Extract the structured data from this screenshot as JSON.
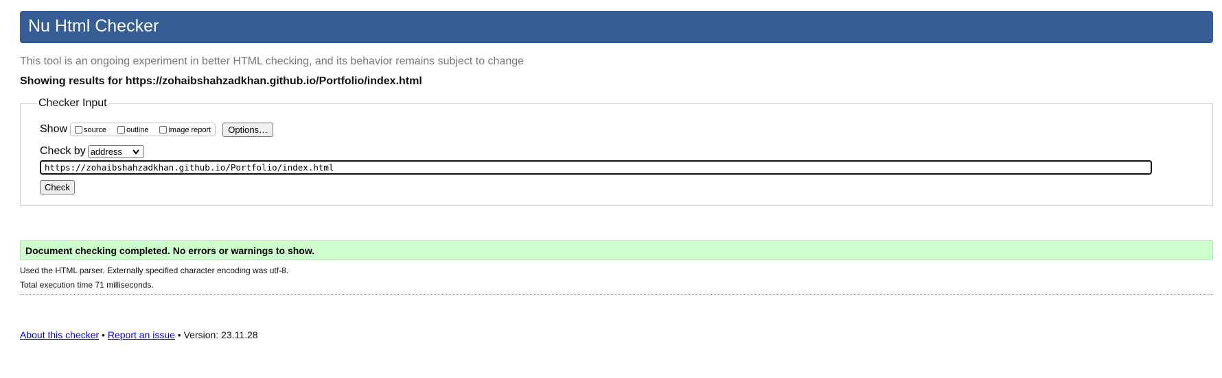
{
  "header": {
    "title": "Nu Html Checker",
    "background_color": "#365d95"
  },
  "subtitle": "This tool is an ongoing experiment in better HTML checking, and its behavior remains subject to change",
  "results_heading": {
    "prefix": "Showing results for ",
    "url": "https://zohaibshahzadkhan.github.io/Portfolio/index.html"
  },
  "checker_input": {
    "legend": "Checker Input",
    "show_label": "Show",
    "show_options": [
      {
        "label": "source",
        "checked": false
      },
      {
        "label": "outline",
        "checked": false
      },
      {
        "label": "image report",
        "checked": false
      }
    ],
    "options_button": "Options…",
    "check_by_label": "Check by",
    "check_by_selected": "address",
    "url_value": "https://zohaibshahzadkhan.github.io/Portfolio/index.html",
    "check_button": "Check"
  },
  "result": {
    "message": "Document checking completed. No errors or warnings to show.",
    "success_color": "#ccffcc",
    "parser_info": "Used the HTML parser. Externally specified character encoding was utf-8.",
    "execution_time": "Total execution time 71 milliseconds."
  },
  "footer": {
    "about_link": "About this checker",
    "separator": " • ",
    "report_link": "Report an issue",
    "version_text": " • Version: 23.11.28",
    "link_color": "#0000ee"
  }
}
